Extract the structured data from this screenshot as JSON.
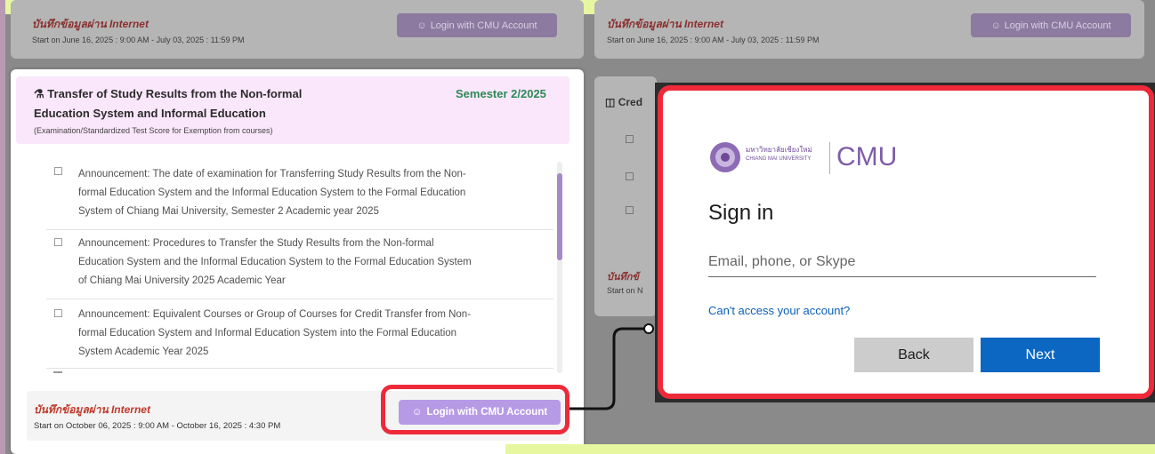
{
  "colors": {
    "accent_red": "#ee2a3a",
    "purple_button": "#b79ae6",
    "semester_green": "#2a8a56",
    "ms_blue": "#0b67c2"
  },
  "bg_left_card": {
    "status": "บันทึกข้อมูลผ่าน Internet",
    "dates": "Start on June 16, 2025 : 9:00 AM - July 03, 2025 : 11:59 PM",
    "login_label": "Login with CMU Account"
  },
  "bg_right_card": {
    "status": "บันทึกข้อมูลผ่าน Internet",
    "dates": "Start on June 16, 2025 : 9:00 AM - July 03, 2025 : 11:59 PM",
    "login_label": "Login with CMU Account",
    "section_title_partial": "Cred",
    "status_partial": "บันทึกข้",
    "dates_partial": "Start on N"
  },
  "main_card": {
    "title_line1": "Transfer of Study Results from the Non-formal",
    "title_line2": "Education System and Informal Education",
    "semester": "Semester 2/2025",
    "subtitle": "(Examination/Standardized Test Score for Exemption from courses)",
    "announcements": [
      {
        "lines": [
          "Announcement: The date of examination for Transferring Study Results from the Non-",
          "formal Education System and the Informal Education System to the Formal Education",
          "System of Chiang Mai University, Semester 2 Academic year 2025"
        ]
      },
      {
        "lines": [
          "Announcement: Procedures to Transfer the Study Results from the Non-formal",
          "Education System and the Informal Education System to the Formal Education System",
          "of Chiang Mai University 2025 Academic Year"
        ]
      },
      {
        "lines": [
          "Announcement: Equivalent Courses or Group of Courses for Credit Transfer from Non-",
          "formal Education System and Informal Education System into the Formal Education",
          "System Academic Year 2025"
        ]
      }
    ],
    "footer_status": "บันทึกข้อมูลผ่าน Internet",
    "footer_dates": "Start on October 06, 2025 : 9:00 AM - October 16, 2025 : 4:30 PM",
    "login_label": "Login with CMU Account"
  },
  "signin": {
    "logo_thai": "มหาวิทยาลัยเชียงใหม่",
    "logo_en": "CHIANG MAI UNIVERSITY",
    "brand": "CMU",
    "heading": "Sign in",
    "email_placeholder": "Email, phone, or Skype",
    "cant_access": "Can't access your account?",
    "back_label": "Back",
    "next_label": "Next"
  }
}
